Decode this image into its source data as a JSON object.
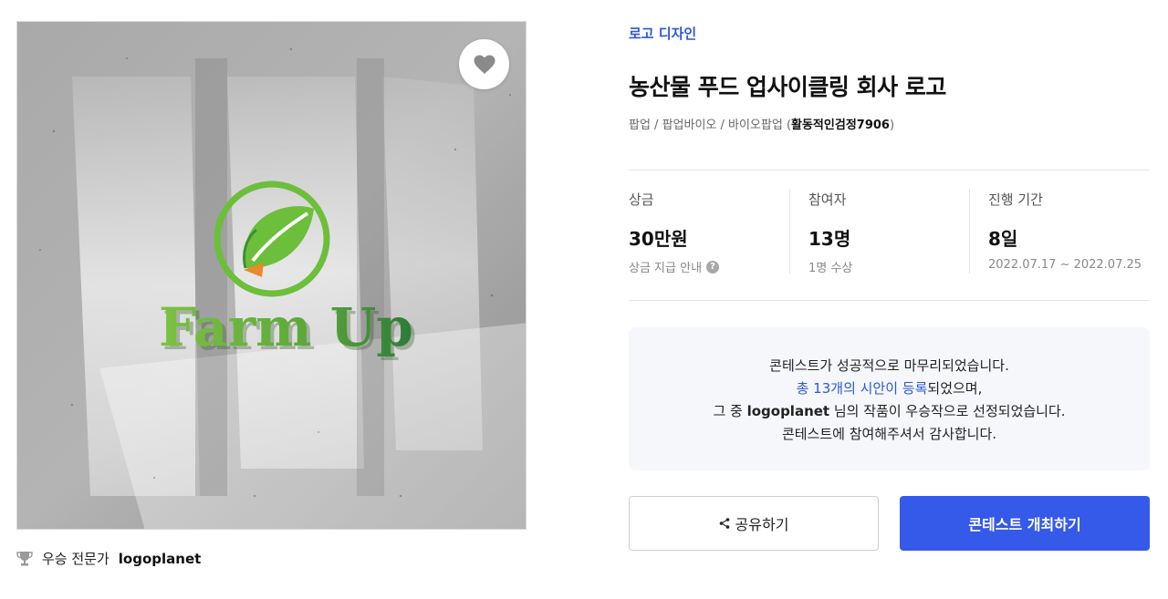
{
  "hero": {
    "logo_text": "Farm Up"
  },
  "winner": {
    "label": "우승 전문가",
    "name": "logoplanet"
  },
  "contest": {
    "category": "로고 디자인",
    "title": "농산물 푸드 업사이클링 회사 로고",
    "tags": "팝업 / 팝업바이오 / 바이오팝업 (",
    "owner": "활동적인검정7906",
    "tags_close": ")"
  },
  "stats": {
    "prize": {
      "label": "상금",
      "value": "30만원",
      "sub": "상금 지급 안내",
      "help": "?"
    },
    "participants": {
      "label": "참여자",
      "value": "13명",
      "sub": "1명 수상"
    },
    "period": {
      "label": "진행 기간",
      "value": "8일",
      "sub": "2022.07.17 ~ 2022.07.25"
    }
  },
  "notice": {
    "line1": "콘테스트가 성공적으로 마무리되었습니다.",
    "line2_link": "총 13개의 시안이 등록",
    "line2_rest": "되었으며,",
    "line3_pre": "그 중 ",
    "line3_name": "logoplanet",
    "line3_post": " 님의 작품이 우승작으로 선정되었습니다.",
    "line4": "콘테스트에 참여해주셔서 감사합니다."
  },
  "buttons": {
    "share": "공유하기",
    "host": "콘테스트 개최하기"
  },
  "colors": {
    "accent": "#3559e8",
    "link": "#2e58d6",
    "logo_green": "#6cbf3a",
    "logo_dark_green": "#2f7a3a",
    "logo_orange": "#e98a2c"
  }
}
